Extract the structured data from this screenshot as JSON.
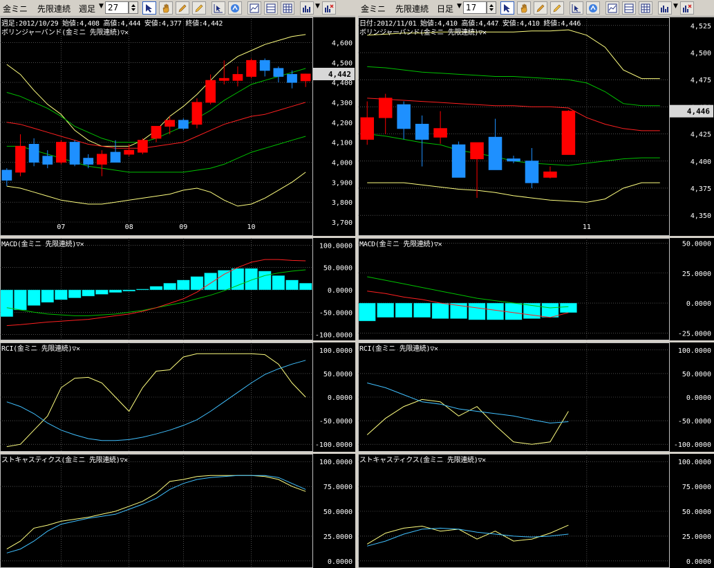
{
  "left": {
    "toolbar": {
      "symbol": "金ミニ",
      "mode": "先限連続",
      "period": "週足",
      "count": "27"
    },
    "ohlc": "週足:2012/10/29 始値:4,408 高値:4,444 安値:4,377 終値:4,442",
    "price_panel": {
      "title": "ボリンジャーバンド(金ミニ 先限連続)▽✕",
      "current_price": "4,442"
    },
    "macd_panel": {
      "title": "MACD(金ミニ 先限連続)▽✕"
    },
    "rci_panel": {
      "title": "RCI(金ミニ 先限連続)▽✕"
    },
    "stoch_panel": {
      "title": "ストキャスティクス(金ミニ 先限連続)▽✕"
    }
  },
  "right": {
    "toolbar": {
      "symbol": "金ミニ",
      "mode": "先限連続",
      "period": "日足",
      "count": "17"
    },
    "ohlc": "日付:2012/11/01 始値:4,410 高値:4,447 安値:4,410 終値:4,446",
    "price_panel": {
      "title": "ボリンジャーバンド(金ミニ 先限連続)▽✕",
      "current_price": "4,446"
    },
    "macd_panel": {
      "title": "MACD(金ミニ 先限連続)▽✕"
    },
    "rci_panel": {
      "title": "RCI(金ミニ 先限連続)▽✕"
    },
    "stoch_panel": {
      "title": "ストキャスティクス(金ミニ 先限連続)▽✕"
    }
  },
  "colors": {
    "up": "#ff0000",
    "down": "#1e90ff",
    "upper_band": "#ffff80",
    "mid_band": "#00c000",
    "ma": "#ff2020",
    "macd_hist": "#00ffff",
    "signal": "#00c000",
    "rci_short": "#ffff80",
    "rci_long": "#40c0ff",
    "pct_k": "#ffff80",
    "pct_d": "#40c0ff",
    "grid": "#808080"
  },
  "chart_data": [
    {
      "id": "left-price",
      "type": "candlestick",
      "title": "ボリンジャーバンド(金ミニ 先限連続)",
      "ylim": [
        3700,
        4650
      ],
      "yticks": [
        3700,
        3800,
        3900,
        4000,
        4100,
        4200,
        4300,
        4400,
        4500,
        4600
      ],
      "ytick_labels": [
        "3,700",
        "3,800",
        "3,900",
        "4,000",
        "4,100",
        "4,200",
        "4,300",
        "4,400",
        "4,500",
        "4,600"
      ],
      "x_labels": [
        {
          "i": 4,
          "label": "07"
        },
        {
          "i": 9,
          "label": "08"
        },
        {
          "i": 13,
          "label": "09"
        },
        {
          "i": 18,
          "label": "10"
        }
      ],
      "n": 23,
      "candles": [
        [
          3960,
          3970,
          3880,
          3910
        ],
        [
          3950,
          4140,
          3930,
          4080
        ],
        [
          4090,
          4120,
          3980,
          4000
        ],
        [
          4030,
          4060,
          3970,
          3990
        ],
        [
          4000,
          4110,
          3990,
          4100
        ],
        [
          4100,
          4110,
          3980,
          3990
        ],
        [
          4020,
          4040,
          3970,
          3990
        ],
        [
          3990,
          4060,
          3930,
          4040
        ],
        [
          4050,
          4110,
          4000,
          4000
        ],
        [
          4040,
          4090,
          4030,
          4060
        ],
        [
          4050,
          4120,
          4040,
          4110
        ],
        [
          4120,
          4180,
          4100,
          4180
        ],
        [
          4180,
          4230,
          4140,
          4210
        ],
        [
          4210,
          4220,
          4160,
          4170
        ],
        [
          4190,
          4320,
          4170,
          4300
        ],
        [
          4300,
          4440,
          4290,
          4410
        ],
        [
          4410,
          4510,
          4390,
          4420
        ],
        [
          4410,
          4480,
          4380,
          4440
        ],
        [
          4430,
          4520,
          4420,
          4510
        ],
        [
          4510,
          4520,
          4430,
          4460
        ],
        [
          4470,
          4480,
          4400,
          4430
        ],
        [
          4440,
          4460,
          4370,
          4400
        ],
        [
          4408,
          4444,
          4377,
          4442
        ]
      ],
      "upper": [
        4490,
        4440,
        4360,
        4290,
        4240,
        4160,
        4110,
        4080,
        4080,
        4080,
        4110,
        4160,
        4230,
        4280,
        4340,
        4410,
        4480,
        4530,
        4560,
        4590,
        4610,
        4630,
        4640
      ],
      "mid": [
        4350,
        4330,
        4300,
        4270,
        4230,
        4180,
        4150,
        4120,
        4100,
        4100,
        4100,
        4120,
        4150,
        4180,
        4220,
        4260,
        4310,
        4350,
        4390,
        4410,
        4430,
        4450,
        4470
      ],
      "ma": [
        4200,
        4190,
        4170,
        4150,
        4130,
        4110,
        4090,
        4080,
        4070,
        4070,
        4070,
        4080,
        4090,
        4100,
        4130,
        4160,
        4190,
        4210,
        4230,
        4240,
        4260,
        4280,
        4300
      ],
      "lower_mid": [
        4080,
        4080,
        4060,
        4040,
        4020,
        4000,
        3980,
        3970,
        3960,
        3950,
        3950,
        3950,
        3950,
        3950,
        3960,
        3970,
        3990,
        4020,
        4050,
        4070,
        4090,
        4110,
        4130
      ],
      "lower": [
        3880,
        3870,
        3850,
        3830,
        3810,
        3800,
        3790,
        3790,
        3800,
        3810,
        3820,
        3830,
        3840,
        3860,
        3870,
        3850,
        3810,
        3780,
        3790,
        3820,
        3860,
        3900,
        3950
      ]
    },
    {
      "id": "left-macd",
      "type": "bar-line",
      "title": "MACD(金ミニ 先限連続)",
      "ylim": [
        -110,
        110
      ],
      "yticks": [
        -100,
        -50,
        0,
        50,
        100
      ],
      "ytick_labels": [
        "-100.0000",
        "-50.0000",
        "0.0000",
        "50.0000",
        "100.0000"
      ],
      "n": 23,
      "hist": [
        -60,
        -45,
        -35,
        -28,
        -22,
        -18,
        -14,
        -10,
        -6,
        -3,
        2,
        8,
        15,
        22,
        30,
        38,
        44,
        48,
        48,
        42,
        32,
        22,
        15
      ],
      "macd": [
        -80,
        -78,
        -75,
        -72,
        -70,
        -68,
        -66,
        -62,
        -58,
        -54,
        -48,
        -40,
        -30,
        -20,
        -5,
        15,
        35,
        50,
        62,
        68,
        68,
        66,
        65
      ],
      "signal": [
        -40,
        -45,
        -50,
        -54,
        -56,
        -58,
        -58,
        -56,
        -54,
        -50,
        -46,
        -40,
        -34,
        -28,
        -20,
        -12,
        -2,
        10,
        22,
        32,
        38,
        42,
        45
      ]
    },
    {
      "id": "left-rci",
      "type": "line",
      "title": "RCI(金ミニ 先限連続)",
      "ylim": [
        -110,
        110
      ],
      "yticks": [
        -100,
        -50,
        0,
        50,
        100
      ],
      "ytick_labels": [
        "-100.0000",
        "-50.0000",
        "0.0000",
        "50.0000",
        "100.0000"
      ],
      "n": 23,
      "short": [
        -105,
        -100,
        -70,
        -40,
        20,
        40,
        42,
        30,
        0,
        -30,
        20,
        55,
        58,
        85,
        92,
        92,
        92,
        92,
        92,
        90,
        70,
        30,
        0
      ],
      "long": [
        -10,
        -20,
        -35,
        -55,
        -70,
        -80,
        -88,
        -92,
        -92,
        -90,
        -85,
        -78,
        -70,
        -60,
        -48,
        -30,
        -10,
        10,
        30,
        48,
        60,
        70,
        78
      ]
    },
    {
      "id": "left-stoch",
      "type": "line",
      "title": "ストキャスティクス(金ミニ 先限連続)",
      "ylim": [
        -5,
        105
      ],
      "yticks": [
        0,
        25,
        50,
        75,
        100
      ],
      "ytick_labels": [
        "0.0000",
        "25.0000",
        "50.0000",
        "75.0000",
        "100.0000"
      ],
      "n": 23,
      "k": [
        12,
        20,
        33,
        36,
        40,
        42,
        44,
        47,
        50,
        55,
        60,
        68,
        80,
        82,
        85,
        86,
        86,
        86,
        86,
        85,
        82,
        75,
        70
      ],
      "d": [
        8,
        12,
        20,
        30,
        37,
        40,
        43,
        45,
        47,
        52,
        57,
        63,
        72,
        78,
        82,
        84,
        85,
        86,
        86,
        86,
        84,
        78,
        72
      ]
    },
    {
      "id": "right-price",
      "type": "candlestick",
      "title": "ボリンジャーバンド(金ミニ 先限連続)",
      "ylim": [
        4345,
        4530
      ],
      "yticks": [
        4350,
        4375,
        4400,
        4425,
        4450,
        4475,
        4500,
        4525
      ],
      "ytick_labels": [
        "4,350",
        "4,375",
        "4,400",
        "4,425",
        "4,450",
        "4,475",
        "4,500",
        "4,525"
      ],
      "x_labels": [
        {
          "i": 12,
          "label": "11"
        }
      ],
      "n": 17,
      "candles": [
        [
          4420,
          4455,
          4415,
          4440
        ],
        [
          4440,
          4462,
          4425,
          4458
        ],
        [
          4452,
          4455,
          4420,
          4430
        ],
        [
          4434,
          4442,
          4395,
          4420
        ],
        [
          4422,
          4446,
          4416,
          4430
        ],
        [
          4415,
          4418,
          4390,
          4385
        ],
        [
          4402,
          4412,
          4366,
          4417
        ],
        [
          4422,
          4439,
          4395,
          4392
        ],
        [
          4402,
          4405,
          4398,
          4400
        ],
        [
          4400,
          4412,
          4375,
          4380
        ],
        [
          4385,
          4395,
          4384,
          4390
        ],
        [
          4406,
          4447,
          4410,
          4446
        ],
        null,
        null,
        null,
        null,
        null
      ],
      "upper": [
        4516,
        4517,
        4518,
        4518,
        4519,
        4519,
        4519,
        4519,
        4519,
        4520,
        4520,
        4521,
        4516,
        4505,
        4484,
        4476,
        4476
      ],
      "mid": [
        4487,
        4486,
        4484,
        4482,
        4481,
        4480,
        4479,
        4478,
        4478,
        4477,
        4476,
        4475,
        4472,
        4464,
        4453,
        4451,
        4451
      ],
      "ma": [
        4458,
        4457,
        4456,
        4455,
        4454,
        4453,
        4452,
        4451,
        4451,
        4450,
        4450,
        4449,
        4440,
        4434,
        4430,
        4428,
        4428
      ],
      "lower_mid": [
        4425,
        4423,
        4420,
        4417,
        4415,
        4410,
        4407,
        4404,
        4400,
        4398,
        4397,
        4396,
        4398,
        4400,
        4402,
        4403,
        4403
      ],
      "lower": [
        4380,
        4380,
        4380,
        4378,
        4376,
        4374,
        4373,
        4371,
        4368,
        4366,
        4364,
        4363,
        4362,
        4365,
        4375,
        4380,
        4380
      ]
    },
    {
      "id": "right-macd",
      "type": "bar-line",
      "title": "MACD(金ミニ 先限連続)",
      "ylim": [
        -30,
        52
      ],
      "yticks": [
        -25,
        0,
        25,
        50
      ],
      "ytick_labels": [
        "-25.0000",
        "0.0000",
        "25.0000",
        "50.0000"
      ],
      "n": 17,
      "hist": [
        -15,
        -12,
        -12,
        -12,
        -13,
        -13,
        -14,
        -14,
        -14,
        -13,
        -12,
        -8,
        null,
        null,
        null,
        null,
        null
      ],
      "macd": [
        10,
        8,
        5,
        3,
        0,
        -2,
        -4,
        -6,
        -8,
        -10,
        -12,
        -8,
        null,
        null,
        null,
        null,
        null
      ],
      "signal": [
        22,
        19,
        16,
        13,
        10,
        7,
        4,
        2,
        0,
        -2,
        -4,
        -3,
        null,
        null,
        null,
        null,
        null
      ]
    },
    {
      "id": "right-rci",
      "type": "line",
      "title": "RCI(金ミニ 先限連続)",
      "ylim": [
        -110,
        110
      ],
      "yticks": [
        -100,
        -50,
        0,
        50,
        100
      ],
      "ytick_labels": [
        "-100.0000",
        "-50.0000",
        "0.0000",
        "50.0000",
        "100.0000"
      ],
      "n": 17,
      "short": [
        -80,
        -45,
        -20,
        -5,
        -10,
        -40,
        -20,
        -60,
        -95,
        -100,
        -95,
        -30,
        null,
        null,
        null,
        null,
        null
      ],
      "long": [
        30,
        20,
        5,
        -10,
        -15,
        -25,
        -30,
        -35,
        -40,
        -48,
        -55,
        -52,
        null,
        null,
        null,
        null,
        null
      ]
    },
    {
      "id": "right-stoch",
      "type": "line",
      "title": "ストキャスティクス(金ミニ 先限連続)",
      "ylim": [
        -5,
        105
      ],
      "yticks": [
        0,
        25,
        50,
        75,
        100
      ],
      "ytick_labels": [
        "0.0000",
        "25.0000",
        "50.0000",
        "75.0000",
        "100.0000"
      ],
      "n": 17,
      "k": [
        17,
        28,
        33,
        35,
        30,
        32,
        22,
        30,
        20,
        22,
        28,
        36,
        null,
        null,
        null,
        null,
        null
      ],
      "d": [
        15,
        20,
        27,
        32,
        33,
        32,
        29,
        27,
        25,
        24,
        25,
        27,
        null,
        null,
        null,
        null,
        null
      ]
    }
  ]
}
